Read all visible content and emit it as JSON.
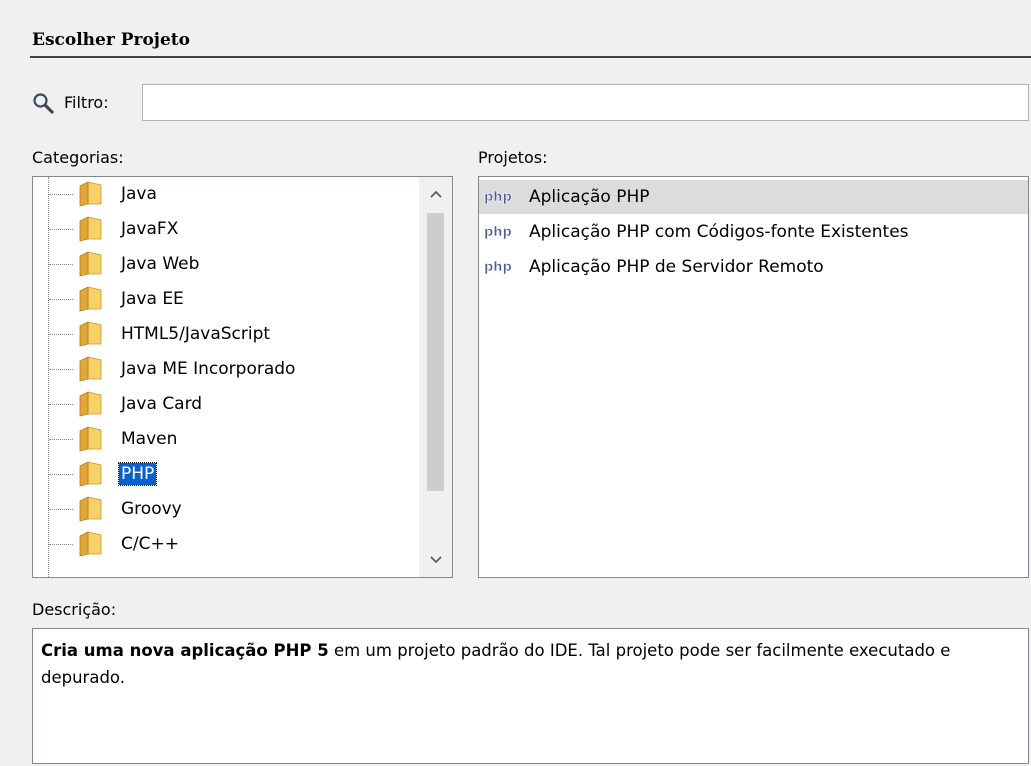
{
  "header": {
    "title": "Escolher Projeto"
  },
  "filter": {
    "label": "Filtro:",
    "value": "",
    "placeholder": ""
  },
  "categories": {
    "label": "Categorias:",
    "items": [
      {
        "label": "Java"
      },
      {
        "label": "JavaFX"
      },
      {
        "label": "Java Web"
      },
      {
        "label": "Java EE"
      },
      {
        "label": "HTML5/JavaScript"
      },
      {
        "label": "Java ME Incorporado"
      },
      {
        "label": "Java Card"
      },
      {
        "label": "Maven"
      },
      {
        "label": "PHP"
      },
      {
        "label": "Groovy"
      },
      {
        "label": "C/C++"
      }
    ],
    "selected": "PHP",
    "item_icon": "folder-icon"
  },
  "projects": {
    "label": "Projetos:",
    "items": [
      {
        "label": "Aplicação PHP",
        "icon": "php-icon",
        "icon_text": "php"
      },
      {
        "label": "Aplicação PHP com Códigos-fonte Existentes",
        "icon": "php-icon",
        "icon_text": "php"
      },
      {
        "label": "Aplicação PHP de Servidor Remoto",
        "icon": "php-icon",
        "icon_text": "php"
      }
    ],
    "selected": "Aplicação PHP"
  },
  "description": {
    "label": "Descrição:",
    "bold": "Cria uma nova aplicação PHP 5",
    "rest": " em um projeto padrão do IDE. Tal projeto pode ser facilmente executado e depurado."
  },
  "colors": {
    "selection": "#0b61cc",
    "project_selection": "#dcdcdc",
    "folder": "#f3c44e",
    "php_icon": "#4a5e95"
  }
}
